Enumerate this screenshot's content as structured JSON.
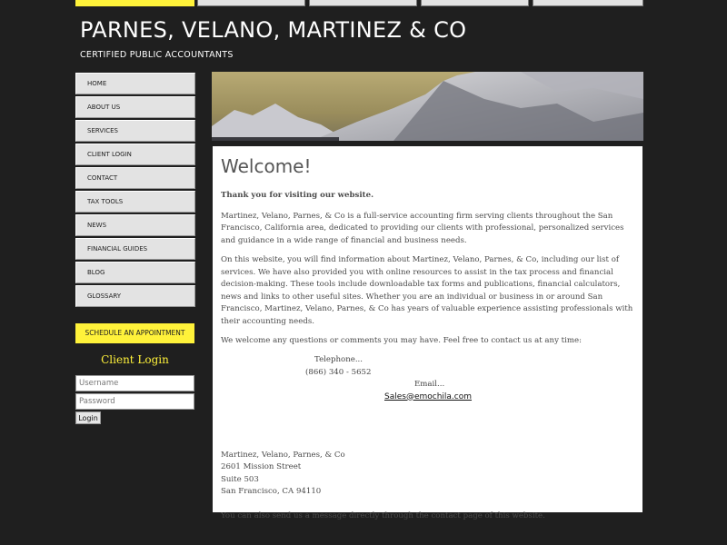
{
  "header": {
    "title": "PARNES, VELANO, MARTINEZ & CO",
    "subtitle": "CERTIFIED PUBLIC ACCOUNTANTS"
  },
  "colors": {
    "accent": "#fff23a",
    "background": "#1f1f1f",
    "nav_bg": "#e3e3e3",
    "content_bg": "#ffffff"
  },
  "sidebar": {
    "items": [
      {
        "label": "HOME"
      },
      {
        "label": "ABOUT US"
      },
      {
        "label": "SERVICES"
      },
      {
        "label": "CLIENT LOGIN"
      },
      {
        "label": "CONTACT"
      },
      {
        "label": "TAX TOOLS"
      },
      {
        "label": "NEWS"
      },
      {
        "label": "FINANCIAL GUIDES"
      },
      {
        "label": "BLOG"
      },
      {
        "label": "GLOSSARY"
      }
    ],
    "appointment_label": "SCHEDULE AN APPOINTMENT"
  },
  "login": {
    "heading": "Client Login",
    "username_placeholder": "Username",
    "password_placeholder": "Password",
    "button_label": "Login"
  },
  "main": {
    "title": "Welcome!",
    "intro_bold": "Thank you for visiting our website.",
    "paragraph_1": "Martinez, Velano, Parnes, & Co is a full-service accounting firm serving clients throughout the San Francisco, California area, dedicated to providing our clients with professional, personalized services and guidance in a wide range of financial and business needs.",
    "paragraph_2": "On this website, you will find information about Martinez, Velano, Parnes, & Co, including our list of services. We have also provided you with online resources to assist in the tax process and financial decision-making. These tools include downloadable tax forms and publications, financial calculators, news and links to other useful sites. Whether you are an individual or business in or around San Francisco, Martinez, Velano, Parnes, & Co has years of valuable experience assisting professionals with their accounting needs.",
    "paragraph_3": "We welcome any questions or comments you may have. Feel free to contact us at any time:",
    "contact": {
      "phone_label": "Telephone...",
      "phone_number": "(866) 340 - 5652",
      "email_label": "Email...",
      "email_address": "Sales@emochila.com"
    },
    "address": {
      "line1": "Martinez, Velano, Parnes, & Co",
      "line2": "2601 Mission Street",
      "line3": "Suite 503",
      "line4": "San Francisco, CA 94110"
    },
    "closing": "You can also send us a message directly through the contact page of this website."
  },
  "icons": {
    "banner": "mountain-banner-image"
  }
}
